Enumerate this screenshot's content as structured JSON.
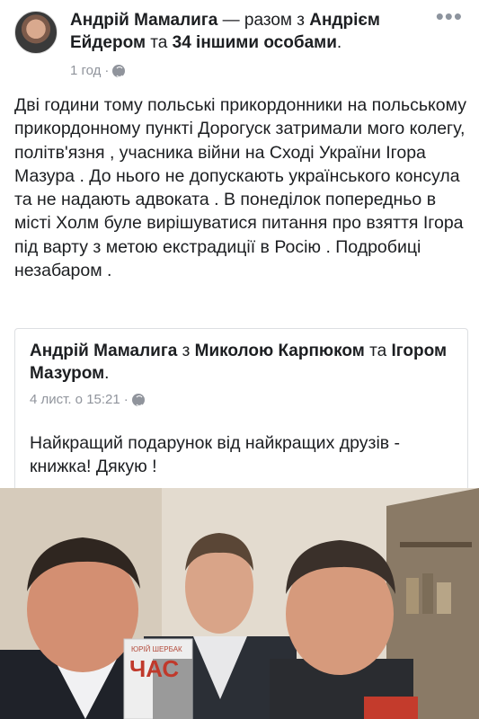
{
  "post": {
    "author_name": "Андрій Мамалига",
    "with_text": " — разом з ",
    "tagged_friend": "Андрієм Ейдером",
    "and_text": " та ",
    "others": "34 іншими особами",
    "period": ".",
    "time": "1 год",
    "sep": "·",
    "privacy_icon": "globe-icon",
    "more": "•••",
    "text": "Дві години тому польські прикордонники на польському прикордонному пункті Дорогуск затримали мого колегу, політв'язня , учасника війни на Сході України Ігора Мазура . До нього не допускають українського консула та не надають адвоката . В понеділок попередньо в місті Холм буле вирішуватися питання про взяття Ігора під варту з метою екстрадиції в Росію . Подробиці незабаром ."
  },
  "shared": {
    "author_name": "Андрій Мамалига",
    "with_text": " з ",
    "tagged_friend": "Миколою Карпюком",
    "and_text": " та ",
    "tagged_friend_2": "Ігором Мазуром",
    "period": ".",
    "time": "4 лист. о 15:21",
    "sep": "·",
    "privacy_icon": "globe-icon",
    "text": "Найкращий подарунок від найкращих друзів - книжка! Дякую !",
    "book_title": "ЧАС",
    "book_author": "ЮРІЙ ШЕРБАК"
  },
  "colors": {
    "text": "#1c1e21",
    "secondary": "#90949c",
    "border": "#dddfe2"
  }
}
